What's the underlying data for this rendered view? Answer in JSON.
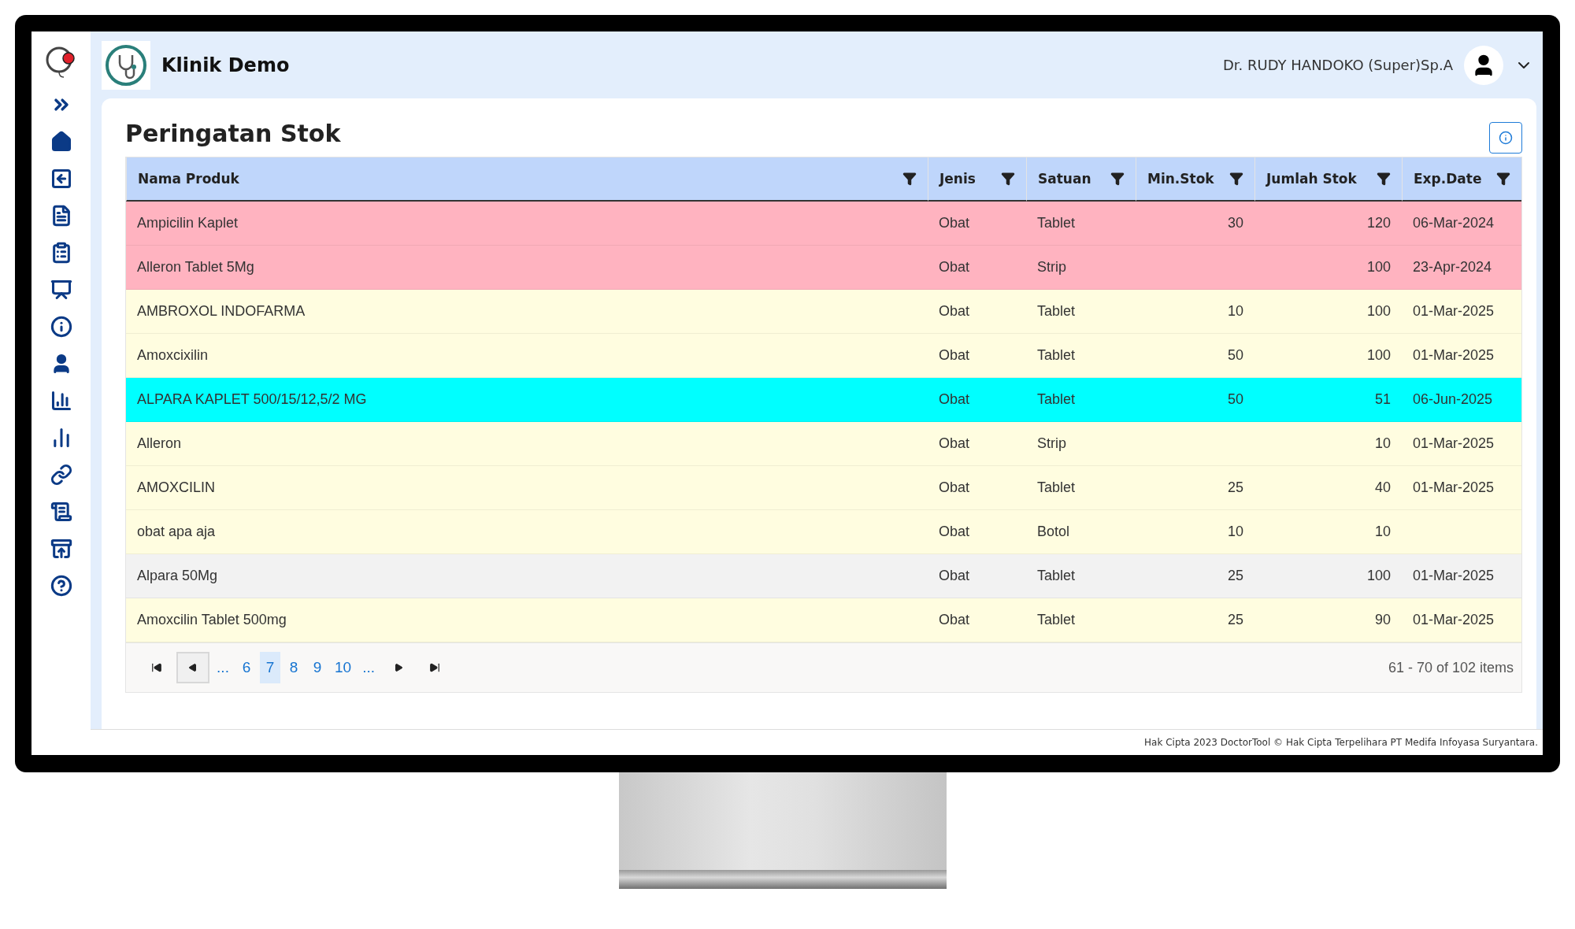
{
  "app": {
    "name": "Klinik Demo"
  },
  "user": {
    "name": "Dr. RUDY HANDOKO (Super)Sp.A"
  },
  "page": {
    "title": "Peringatan Stok"
  },
  "table": {
    "columns": [
      {
        "label": "Nama Produk",
        "kind": "text"
      },
      {
        "label": "Jenis",
        "kind": "text"
      },
      {
        "label": "Satuan",
        "kind": "text"
      },
      {
        "label": "Min.Stok",
        "kind": "number"
      },
      {
        "label": "Jumlah Stok",
        "kind": "number"
      },
      {
        "label": "Exp.Date",
        "kind": "text"
      }
    ],
    "rows": [
      {
        "color": "#ffb3c0",
        "cells": [
          "Ampicilin Kaplet",
          "Obat",
          "Tablet",
          "30",
          "120",
          "06-Mar-2024"
        ]
      },
      {
        "color": "#ffb3c0",
        "cells": [
          "Alleron Tablet 5Mg",
          "Obat",
          "Strip",
          null,
          "100",
          "23-Apr-2024"
        ]
      },
      {
        "color": "#fffde0",
        "cells": [
          "AMBROXOL INDOFARMA",
          "Obat",
          "Tablet",
          "10",
          "100",
          "01-Mar-2025"
        ]
      },
      {
        "color": "#fffde0",
        "cells": [
          "Amoxcixilin",
          "Obat",
          "Tablet",
          "50",
          "100",
          "01-Mar-2025"
        ]
      },
      {
        "color": "#00ffff",
        "cells": [
          "ALPARA KAPLET 500/15/12,5/2 MG",
          "Obat",
          "Tablet",
          "50",
          "51",
          "06-Jun-2025"
        ]
      },
      {
        "color": "#fffde0",
        "cells": [
          "Alleron",
          "Obat",
          "Strip",
          null,
          "10",
          "01-Mar-2025"
        ]
      },
      {
        "color": "#fffde0",
        "cells": [
          "AMOXCILIN",
          "Obat",
          "Tablet",
          "25",
          "40",
          "01-Mar-2025"
        ]
      },
      {
        "color": "#fffde0",
        "cells": [
          "obat apa aja",
          "Obat",
          "Botol",
          "10",
          "10",
          null
        ]
      },
      {
        "color": "#f2f2f2",
        "cells": [
          "Alpara 50Mg",
          "Obat",
          "Tablet",
          "25",
          "100",
          "01-Mar-2025"
        ]
      },
      {
        "color": "#fffde0",
        "cells": [
          "Amoxcilin Tablet 500mg",
          "Obat",
          "Tablet",
          "25",
          "90",
          "01-Mar-2025"
        ]
      }
    ]
  },
  "pagination": {
    "pages": [
      {
        "label": "...",
        "selected": false
      },
      {
        "label": "6",
        "selected": false
      },
      {
        "label": "7",
        "selected": true
      },
      {
        "label": "8",
        "selected": false
      },
      {
        "label": "9",
        "selected": false
      },
      {
        "label": "10",
        "selected": false
      },
      {
        "label": "...",
        "selected": false
      }
    ],
    "summary": "61 - 70 of 102 items"
  },
  "footer": "Hak Cipta 2023 DoctorTool © Hak Cipta Terpelihara PT Medifa Infoyasa Suryantara."
}
